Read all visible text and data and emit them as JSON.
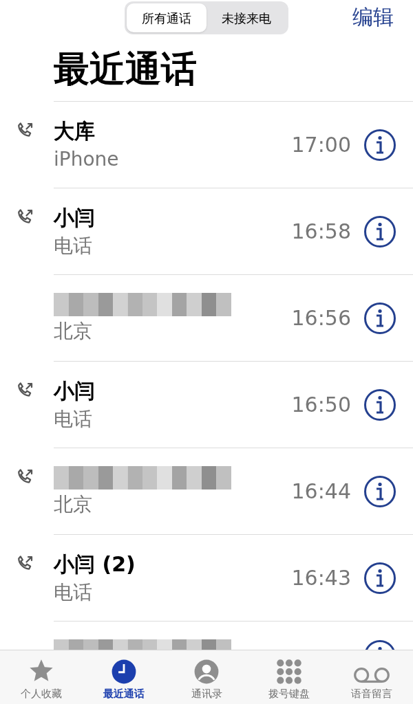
{
  "segments": [
    {
      "label": "所有通话",
      "selected": true
    },
    {
      "label": "未接来电",
      "selected": false
    }
  ],
  "edit_button": "编辑",
  "title": "最近通话",
  "calls": [
    {
      "kind": "named",
      "outgoing": true,
      "name": "大库",
      "subtitle": "iPhone",
      "time": "17:00"
    },
    {
      "kind": "named",
      "outgoing": true,
      "name": "小闫",
      "subtitle": "电话",
      "time": "16:58"
    },
    {
      "kind": "redacted",
      "outgoing": false,
      "subtitle": "北京",
      "time": "16:56"
    },
    {
      "kind": "named",
      "outgoing": true,
      "name": "小闫",
      "subtitle": "电话",
      "time": "16:50"
    },
    {
      "kind": "redacted",
      "outgoing": true,
      "subtitle": "北京",
      "time": "16:44"
    },
    {
      "kind": "named",
      "outgoing": true,
      "name": "小闫 (2)",
      "subtitle": "电话",
      "time": "16:43"
    },
    {
      "kind": "redacted"
    }
  ],
  "tab_bar": [
    {
      "kind": "star",
      "label": "个人收藏",
      "selected": false
    },
    {
      "kind": "clock",
      "label": "最近通话",
      "selected": true
    },
    {
      "kind": "person",
      "label": "通讯录",
      "selected": false
    },
    {
      "kind": "keypad",
      "label": "拨号键盘",
      "selected": false
    },
    {
      "kind": "voicemail",
      "label": "语音留言",
      "selected": false
    }
  ]
}
